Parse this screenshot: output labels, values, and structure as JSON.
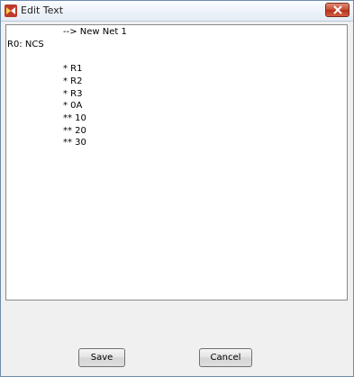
{
  "window": {
    "title": "Edit Text",
    "app_icon": "app-icon",
    "close_icon": "close-icon",
    "accent_close": "#c74a31"
  },
  "editor": {
    "lines": [
      {
        "text": "--> New Net 1"
      },
      {
        "text": "R0: NCS"
      },
      {
        "text": "* R1"
      },
      {
        "text": "* R2"
      },
      {
        "text": "* R3"
      },
      {
        "text": "* 0A"
      },
      {
        "text": "** 10"
      },
      {
        "text": "** 20"
      },
      {
        "text": "** 30"
      }
    ]
  },
  "buttons": {
    "save_label": "Save",
    "cancel_label": "Cancel"
  }
}
